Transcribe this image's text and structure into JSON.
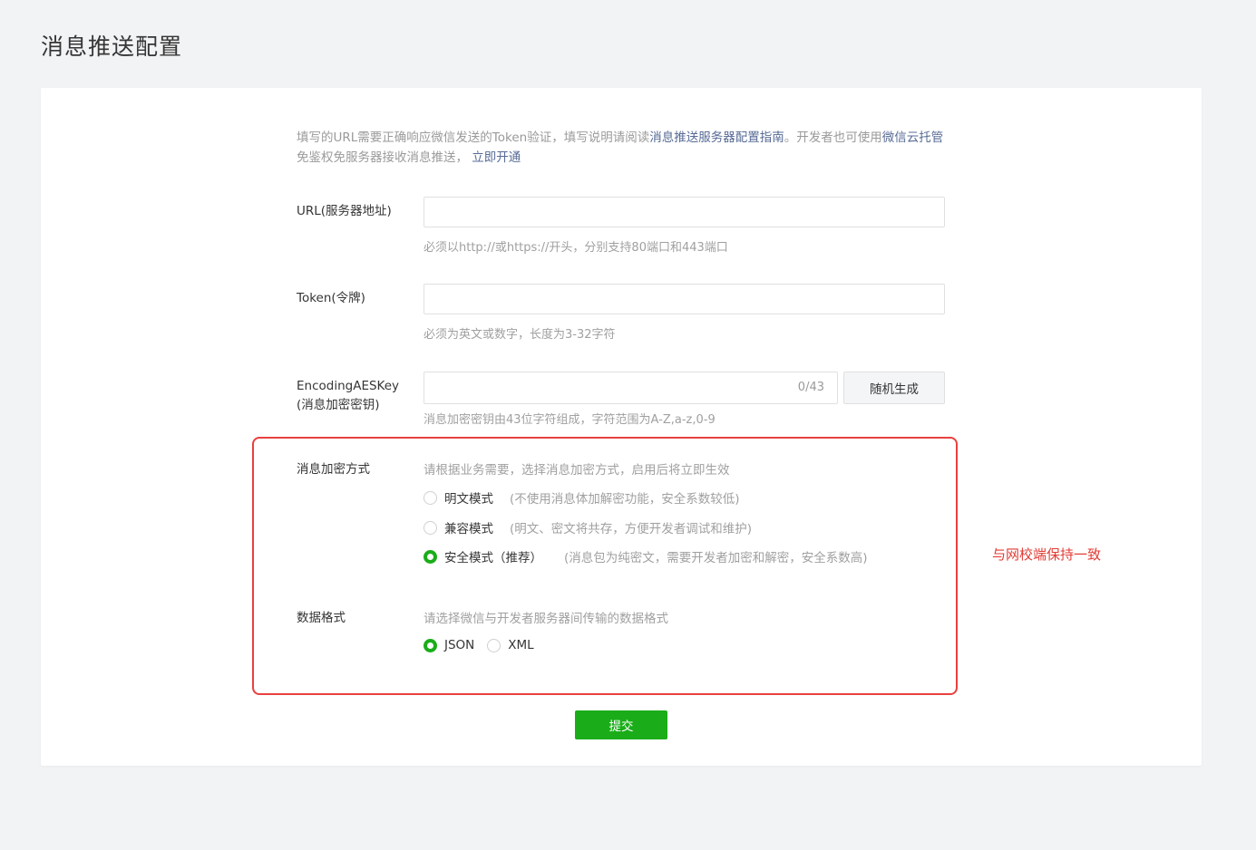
{
  "page": {
    "title": "消息推送配置"
  },
  "intro": {
    "part1": "填写的URL需要正确响应微信发送的Token验证，填写说明请阅读",
    "link1": "消息推送服务器配置指南",
    "part2": "。开发者也可使用",
    "link2": "微信云托管",
    "part3": "免鉴权免服务器接收消息推送，",
    "link3": "立即开通"
  },
  "url_field": {
    "label": "URL(服务器地址)",
    "value": "",
    "hint": "必须以http://或https://开头，分别支持80端口和443端口"
  },
  "token_field": {
    "label": "Token(令牌)",
    "value": "",
    "hint": "必须为英文或数字，长度为3-32字符"
  },
  "aes_field": {
    "label_line1": "EncodingAESKey",
    "label_line2": "(消息加密密钥)",
    "value": "",
    "counter": "0/43",
    "random_button": "随机生成",
    "hint": "消息加密密钥由43位字符组成，字符范围为A-Z,a-z,0-9"
  },
  "encryption": {
    "label": "消息加密方式",
    "hint": "请根据业务需要，选择消息加密方式，启用后将立即生效",
    "options": [
      {
        "label": "明文模式",
        "desc": "(不使用消息体加解密功能，安全系数较低)",
        "checked": false
      },
      {
        "label": "兼容模式",
        "desc": "(明文、密文将共存，方便开发者调试和维护)",
        "checked": false
      },
      {
        "label": "安全模式（推荐）",
        "desc": "(消息包为纯密文，需要开发者加密和解密，安全系数高)",
        "checked": true
      }
    ]
  },
  "data_format": {
    "label": "数据格式",
    "hint": "请选择微信与开发者服务器间传输的数据格式",
    "options": [
      {
        "label": "JSON",
        "checked": true
      },
      {
        "label": "XML",
        "checked": false
      }
    ]
  },
  "annotation": "与网校端保持一致",
  "submit_label": "提交",
  "colors": {
    "primary": "#1aad19",
    "link": "#576b95",
    "annotation": "#e23b34"
  }
}
